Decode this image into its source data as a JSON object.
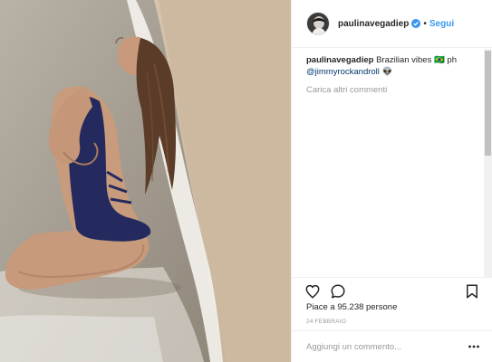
{
  "photo": {
    "alt_icon": "photo",
    "colors": {
      "sand": "#d6c6b0",
      "sea": "#a9a49b",
      "foam": "#efece6",
      "skin": "#c6987b",
      "swimsuit": "#23295c",
      "hair": "#5a3c27"
    }
  },
  "header": {
    "username": "paulinavegadiep",
    "verified_icon": "verified-badge",
    "separator": "•",
    "follow_label": "Segui"
  },
  "caption": {
    "username": "paulinavegadiep",
    "text": " Brazilian vibes 🇧🇷 ph ",
    "mention": "@jimmyrockandroll",
    "emoji": " 👽"
  },
  "comments": {
    "load_more_label": "Carica altri commenti"
  },
  "actions": {
    "like_icon": "heart",
    "comment_icon": "speech-bubble",
    "save_icon": "bookmark"
  },
  "likes": {
    "text": "Piace a 95.238 persone"
  },
  "date": {
    "text": "24 FEBBRAIO"
  },
  "add_comment": {
    "placeholder": "Aggiungi un commento...",
    "more_icon": "ellipsis"
  },
  "theme": {
    "accent": "#3897f0",
    "text": "#262626",
    "muted": "#999999",
    "border": "#efefef"
  }
}
